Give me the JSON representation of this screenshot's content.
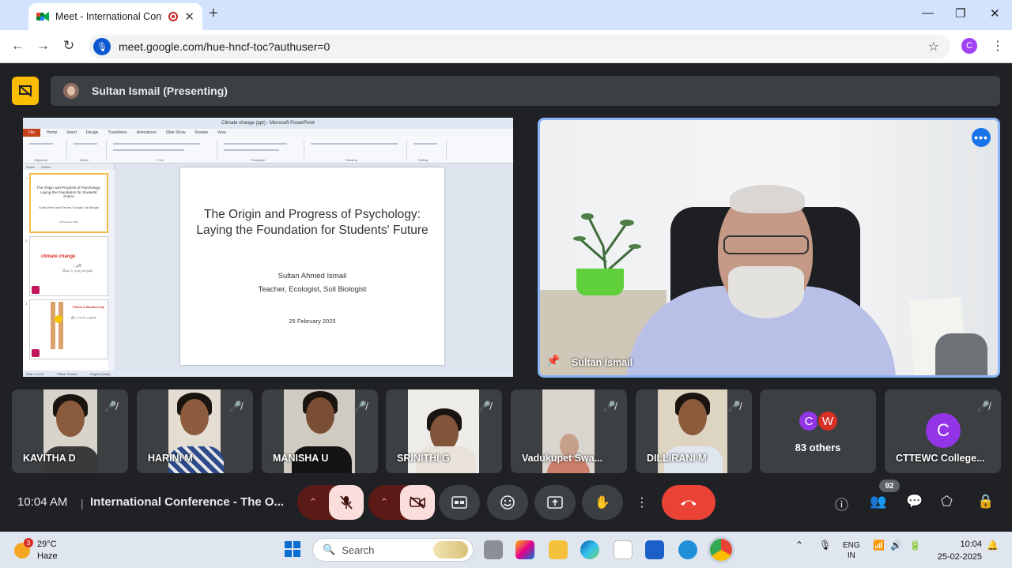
{
  "browser": {
    "tab_title": "Meet - International Confer",
    "new_tab": "+",
    "url": "meet.google.com/hue-hncf-toc?authuser=0",
    "profile_initial": "C",
    "window_controls": [
      "—",
      "❐",
      "✕"
    ]
  },
  "meet": {
    "presenting_label": "Sultan Ismail (Presenting)",
    "shared_screen": {
      "window_title": "Climate change (ppt) - Microsoft PowerPoint",
      "file_tab": "File",
      "ribbon_tabs": [
        "Home",
        "Insert",
        "Design",
        "Transitions",
        "Animations",
        "Slide Show",
        "Review",
        "View"
      ],
      "ribbon_groups": [
        "Clipboard",
        "Slides",
        "Font",
        "Paragraph",
        "Drawing",
        "Editing"
      ],
      "panel_tabs": [
        "Slides",
        "Outline"
      ],
      "thumbnails": [
        {
          "number": "1",
          "title": "The Origin and Progress of Psychology: Laying the Foundation for Students' Future",
          "subtitle": "Sultan Ahmed Ismail Teacher, Ecologist, Soil Biologist",
          "date": "25 February 2025"
        },
        {
          "number": "2",
          "red_text": "climate change",
          "tamil_text": "புவி வெப்பமயமாதல்"
        },
        {
          "number": "3",
          "red_text": "Plants & Biodiversity",
          "tamil_text": "இம் மக்கள் வசதிகள்"
        }
      ],
      "slide": {
        "title": "The Origin and Progress of Psychology: Laying the Foundation for Students' Future",
        "author": "Sultan Ahmed Ismail",
        "role": "Teacher, Ecologist, Soil Biologist",
        "date": "25 February 2025"
      },
      "status": [
        "Slide 1 of 10",
        "\"Office Theme\"",
        "English (India)"
      ]
    },
    "speaker": {
      "name": "Sultan Ismail",
      "more_glyph": "•••"
    },
    "participants": [
      {
        "name": "KAVITHA D",
        "muted": true
      },
      {
        "name": "HARINI M",
        "muted": true
      },
      {
        "name": "MANISHA U",
        "muted": true
      },
      {
        "name": "SRINITHI G",
        "muted": true
      },
      {
        "name": "Vadukupet Swa...",
        "muted": true
      },
      {
        "name": "DILLIRANI M",
        "muted": true
      }
    ],
    "others": {
      "initials": [
        "C",
        "W"
      ],
      "label": "83 others"
    },
    "last_tile": {
      "initial": "C",
      "name": "CTTEWC College..."
    },
    "time": "10:04 AM",
    "meeting_title": "International Conference - The O...",
    "people_count": "92"
  },
  "taskbar": {
    "weather_badge": "3",
    "temperature": "29°C",
    "condition": "Haze",
    "search_label": "Search",
    "lang_top": "ENG",
    "lang_bottom": "IN",
    "time": "10:04",
    "date": "25-02-2025"
  }
}
